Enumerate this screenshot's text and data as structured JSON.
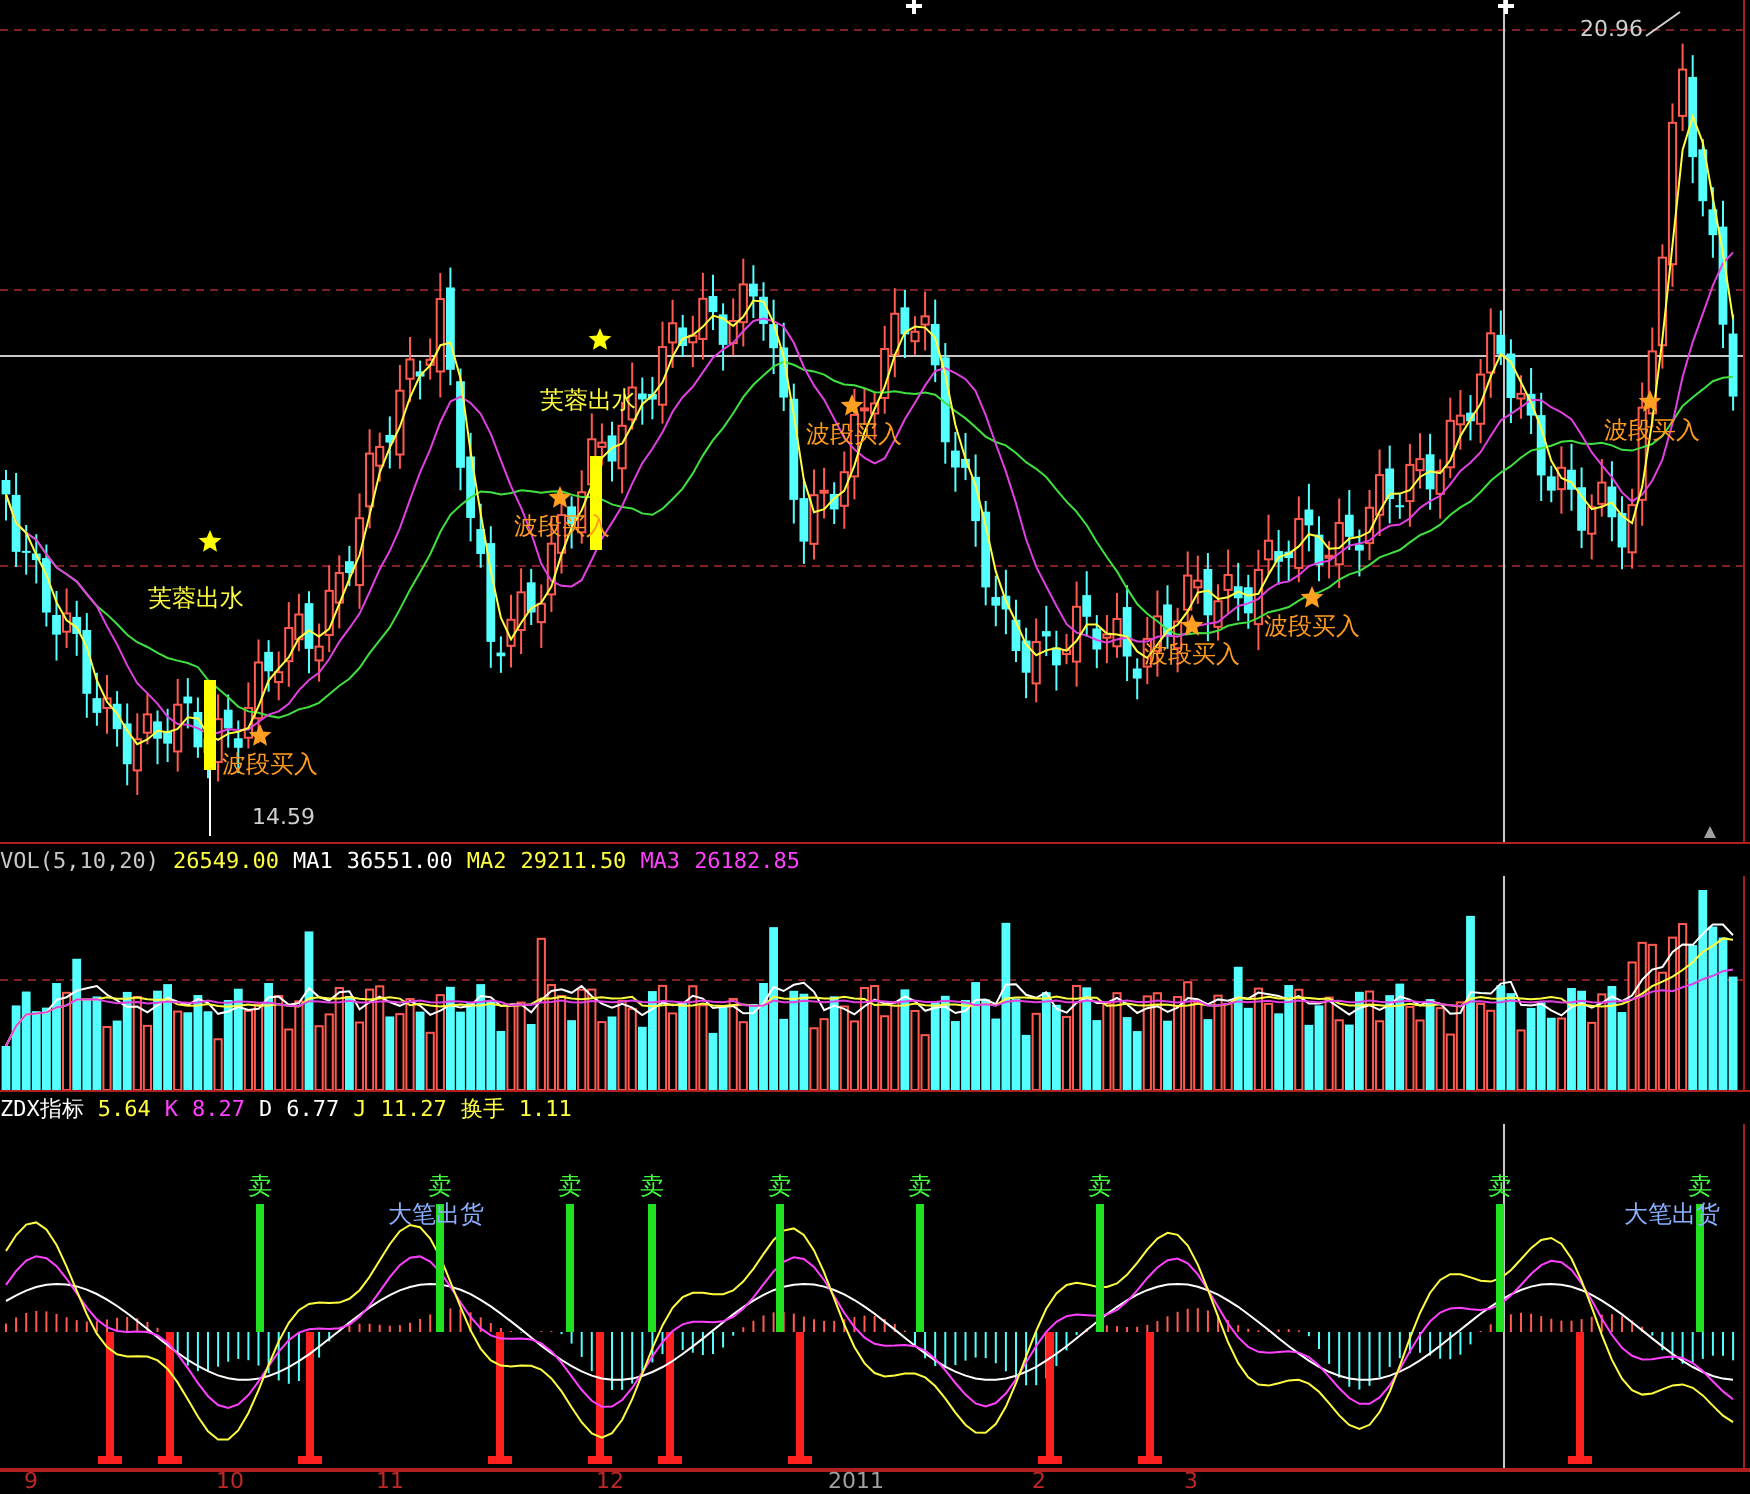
{
  "price_panel": {
    "high_label": "20.96",
    "low_label": "14.59",
    "signals": [
      {
        "kind": "lotus",
        "text": "芙蓉出水"
      },
      {
        "kind": "lotus",
        "text": "芙蓉出水"
      },
      {
        "kind": "buy",
        "text": "波段买入"
      },
      {
        "kind": "buy",
        "text": "波段买入"
      },
      {
        "kind": "buy",
        "text": "波段买入"
      },
      {
        "kind": "buy",
        "text": "波段买入"
      },
      {
        "kind": "buy",
        "text": "波段买入"
      },
      {
        "kind": "buy",
        "text": "波段买入"
      }
    ]
  },
  "volume_panel": {
    "legend": [
      {
        "text": "VOL(5,10,20)",
        "color": "#c8c8c8"
      },
      {
        "text": "26549.00",
        "color": "#ffff40"
      },
      {
        "text": "MA1",
        "color": "#ffffff"
      },
      {
        "text": "36551.00",
        "color": "#ffffff"
      },
      {
        "text": "MA2",
        "color": "#ffff40"
      },
      {
        "text": "29211.50",
        "color": "#ffff40"
      },
      {
        "text": "MA3",
        "color": "#ff40ff"
      },
      {
        "text": "26182.85",
        "color": "#ff40ff"
      }
    ]
  },
  "indicator_panel": {
    "legend": [
      {
        "text": "ZDX指标",
        "color": "#ffffff"
      },
      {
        "text": "5.64",
        "color": "#ffff40"
      },
      {
        "text": "K",
        "color": "#ff40ff"
      },
      {
        "text": "8.27",
        "color": "#ff40ff"
      },
      {
        "text": "D",
        "color": "#ffffff"
      },
      {
        "text": "6.77",
        "color": "#ffffff"
      },
      {
        "text": "J",
        "color": "#ffff40"
      },
      {
        "text": "11.27",
        "color": "#ffff40"
      },
      {
        "text": "换手",
        "color": "#ffff40"
      },
      {
        "text": "1.11",
        "color": "#ffff40"
      }
    ],
    "signals": [
      {
        "kind": "sell",
        "text": "卖"
      },
      {
        "kind": "sell",
        "text": "卖"
      },
      {
        "kind": "sell",
        "text": "卖"
      },
      {
        "kind": "sell",
        "text": "卖"
      },
      {
        "kind": "sell",
        "text": "卖"
      },
      {
        "kind": "sell",
        "text": "卖"
      },
      {
        "kind": "sell",
        "text": "卖"
      },
      {
        "kind": "sell",
        "text": "卖"
      },
      {
        "kind": "sell",
        "text": "卖"
      },
      {
        "kind": "big_sell",
        "text": "大笔出货"
      },
      {
        "kind": "big_sell",
        "text": "大笔出货"
      }
    ]
  },
  "x_axis": [
    {
      "text": "9",
      "color": "#c02828"
    },
    {
      "text": "10",
      "color": "#c02828"
    },
    {
      "text": "11",
      "color": "#c02828"
    },
    {
      "text": "12",
      "color": "#c02828"
    },
    {
      "text": "2011",
      "color": "#a0a0a0"
    },
    {
      "text": "2",
      "color": "#c02828"
    },
    {
      "text": "3",
      "color": "#c02828"
    }
  ]
}
